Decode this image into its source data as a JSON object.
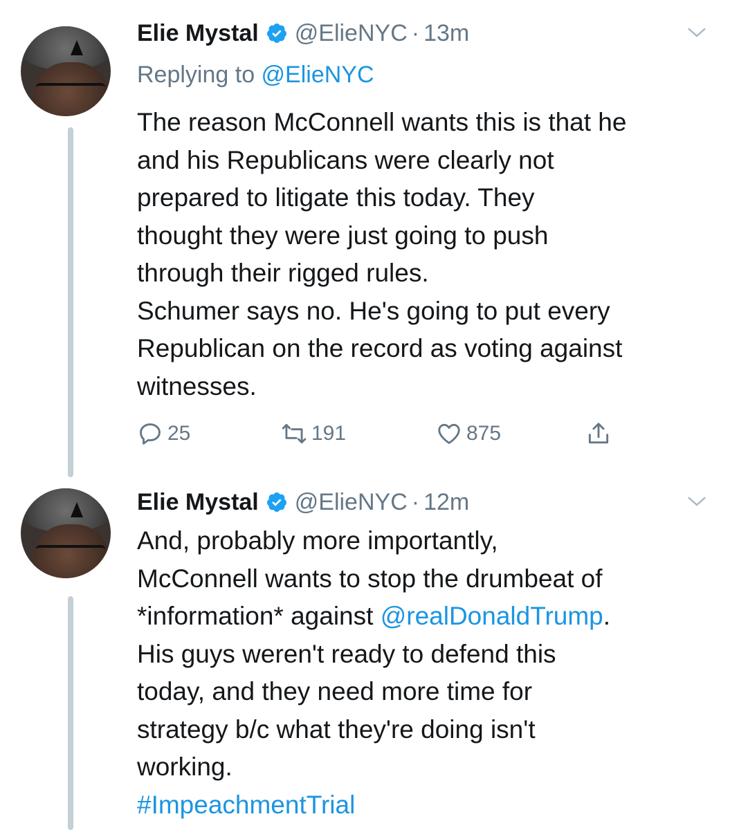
{
  "tweets": [
    {
      "name": "Elie Mystal",
      "handle": "@ElieNYC",
      "separator": "·",
      "time": "13m",
      "replying_prefix": "Replying to ",
      "replying_to": "@ElieNYC",
      "text": "The reason McConnell wants this is that he\nand his Republicans were clearly not\nprepared to litigate this today. They\nthought they were just going to push\nthrough their rigged rules.\nSchumer says no. He's going to put every\nRepublican on the record as voting against\nwitnesses.",
      "replies": "25",
      "retweets": "191",
      "likes": "875"
    },
    {
      "name": "Elie Mystal",
      "handle": "@ElieNYC",
      "separator": "·",
      "time": "12m",
      "text_part1": "And, probably more importantly,\nMcConnell wants to stop the drumbeat of\n*information* against ",
      "mention": "@realDonaldTrump",
      "text_part2": ".\nHis guys weren't ready to defend this\ntoday, and they need more time for\nstrategy b/c what they're doing isn't\nworking.\n",
      "hashtag": "#ImpeachmentTrial"
    }
  ],
  "icons": {
    "verified": "verified-badge-icon",
    "chevron": "chevron-down-icon",
    "reply": "reply-icon",
    "retweet": "retweet-icon",
    "like": "heart-icon",
    "share": "share-icon"
  },
  "colors": {
    "link": "#1b95e0",
    "muted": "#657786",
    "text": "#14171a",
    "thread_line": "#c4cfd6"
  }
}
